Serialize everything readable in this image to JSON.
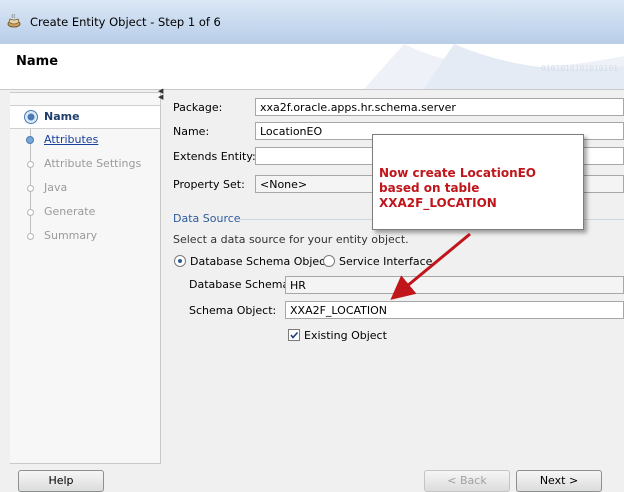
{
  "window": {
    "title": "Create Entity Object - Step 1 of 6"
  },
  "header": {
    "title": "Name",
    "pattern": "0101010101010101"
  },
  "nav": {
    "items": [
      {
        "label": "Name",
        "state": "active"
      },
      {
        "label": "Attributes",
        "state": "link"
      },
      {
        "label": "Attribute Settings",
        "state": "disabled"
      },
      {
        "label": "Java",
        "state": "disabled"
      },
      {
        "label": "Generate",
        "state": "disabled"
      },
      {
        "label": "Summary",
        "state": "disabled"
      }
    ]
  },
  "form": {
    "package": {
      "label": "Package:",
      "value": "xxa2f.oracle.apps.hr.schema.server"
    },
    "name": {
      "label": "Name:",
      "value": "LocationEO"
    },
    "extends": {
      "label": "Extends Entity:",
      "value": ""
    },
    "property_set": {
      "label": "Property Set:",
      "value": "<None>"
    },
    "data_source": {
      "heading": "Data Source",
      "description": "Select a data source for your entity object.",
      "option_db": "Database Schema Object",
      "option_service": "Service Interface",
      "selected": "Database Schema Object",
      "schema_label": "Database Schema:",
      "schema_value": "HR",
      "object_label": "Schema Object:",
      "object_value": "XXA2F_LOCATION",
      "existing_label": "Existing Object",
      "existing_checked": true
    }
  },
  "callout": {
    "text": "Now create LocationEO based on table XXA2F_LOCATION",
    "color": "#c0151b"
  },
  "buttons": {
    "help": "Help",
    "back": "< Back",
    "next": "Next >"
  }
}
